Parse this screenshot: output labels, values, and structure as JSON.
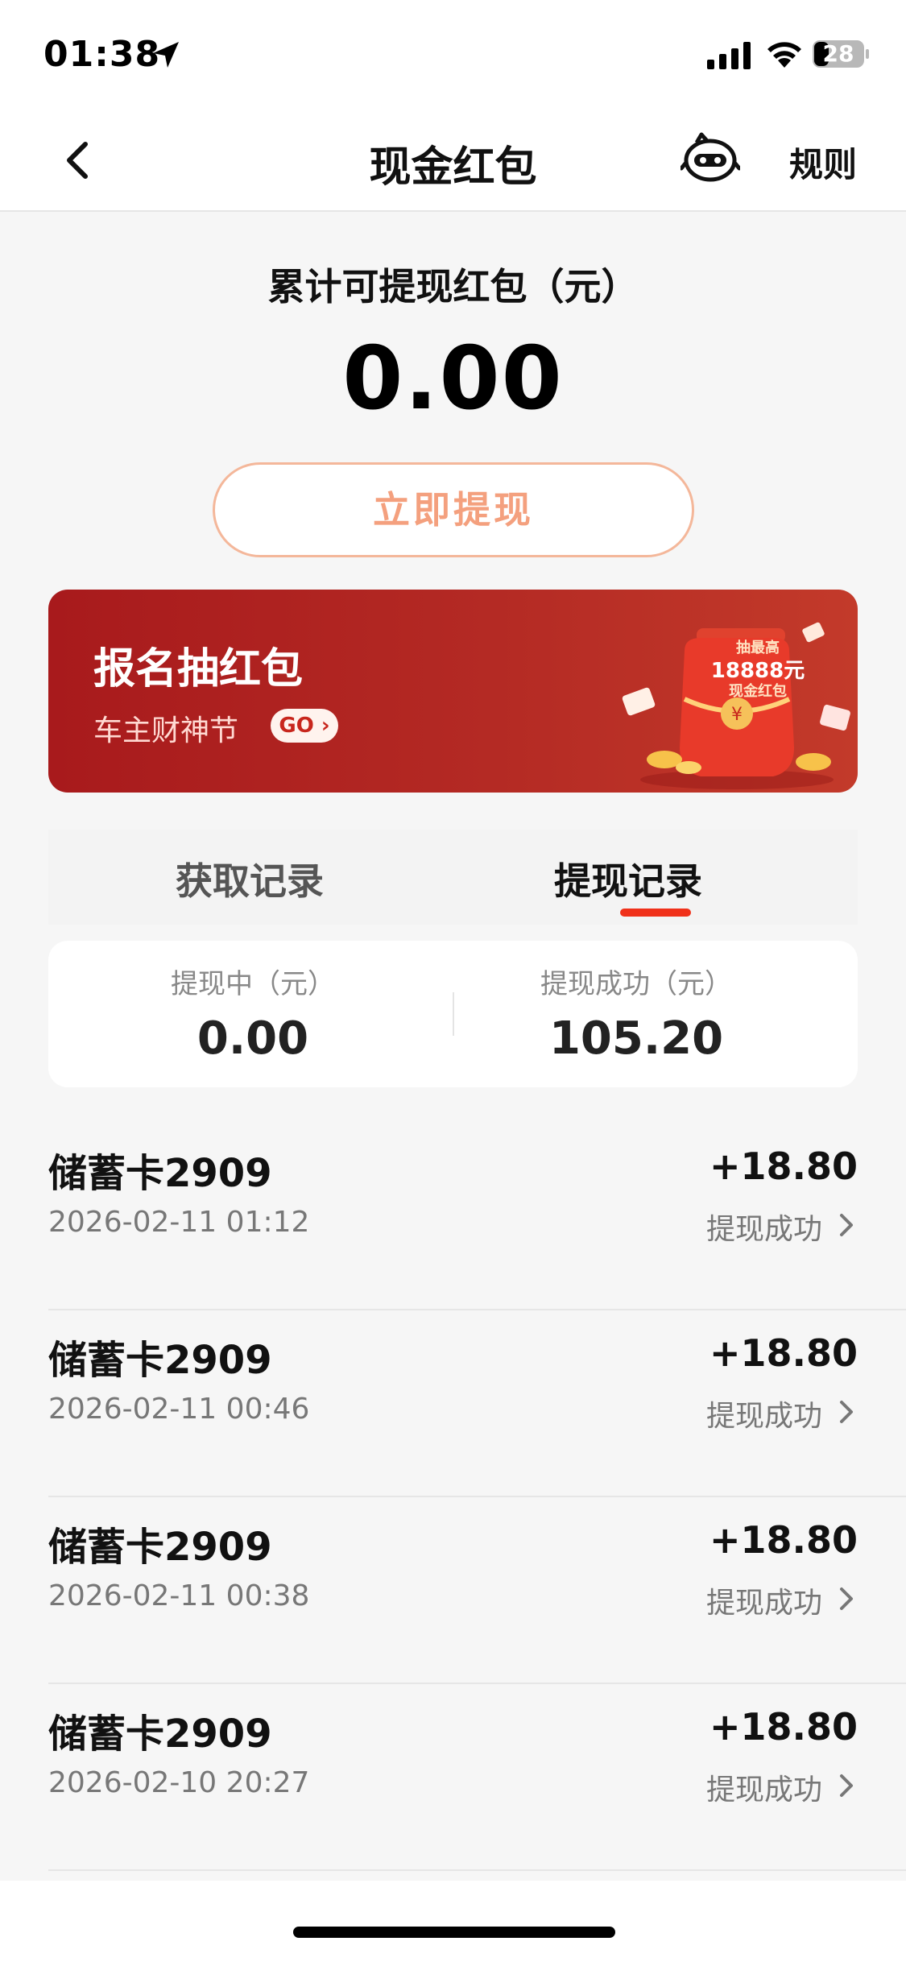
{
  "status_bar": {
    "time": "01:38",
    "battery": "28",
    "icons": [
      "location-arrow-icon",
      "cell-signal-icon",
      "wifi-icon",
      "battery-icon"
    ]
  },
  "nav": {
    "title": "现金红包",
    "rules_label": "规则",
    "icons": [
      "back-chevron-icon",
      "mascot-icon"
    ]
  },
  "summary_top": {
    "label": "累计可提现红包（元）",
    "amount": "0.00",
    "withdraw_button": "立即提现"
  },
  "banner": {
    "title": "报名抽红包",
    "subtitle": "车主财神节",
    "go_label": "GO",
    "jar_line1": "抽最高",
    "jar_line2": "18888元",
    "jar_line3": "现金红包"
  },
  "tabs": {
    "items": [
      {
        "label": "获取记录",
        "active": false
      },
      {
        "label": "提现记录",
        "active": true
      }
    ]
  },
  "withdraw_summary": {
    "pending_label": "提现中（元）",
    "pending_value": "0.00",
    "success_label": "提现成功（元）",
    "success_value": "105.20"
  },
  "records": [
    {
      "title": "储蓄卡2909",
      "time": "2026-02-11 01:12",
      "amount": "+18.80",
      "status": "提现成功"
    },
    {
      "title": "储蓄卡2909",
      "time": "2026-02-11 00:46",
      "amount": "+18.80",
      "status": "提现成功"
    },
    {
      "title": "储蓄卡2909",
      "time": "2026-02-11 00:38",
      "amount": "+18.80",
      "status": "提现成功"
    },
    {
      "title": "储蓄卡2909",
      "time": "2026-02-10 20:27",
      "amount": "+18.80",
      "status": "提现成功"
    }
  ],
  "colors": {
    "accent_red": "#f0311a",
    "banner_red": "#b42a24",
    "button_outline": "#f4b79a",
    "button_text": "#f4a07e",
    "background": "#f6f6f6"
  }
}
